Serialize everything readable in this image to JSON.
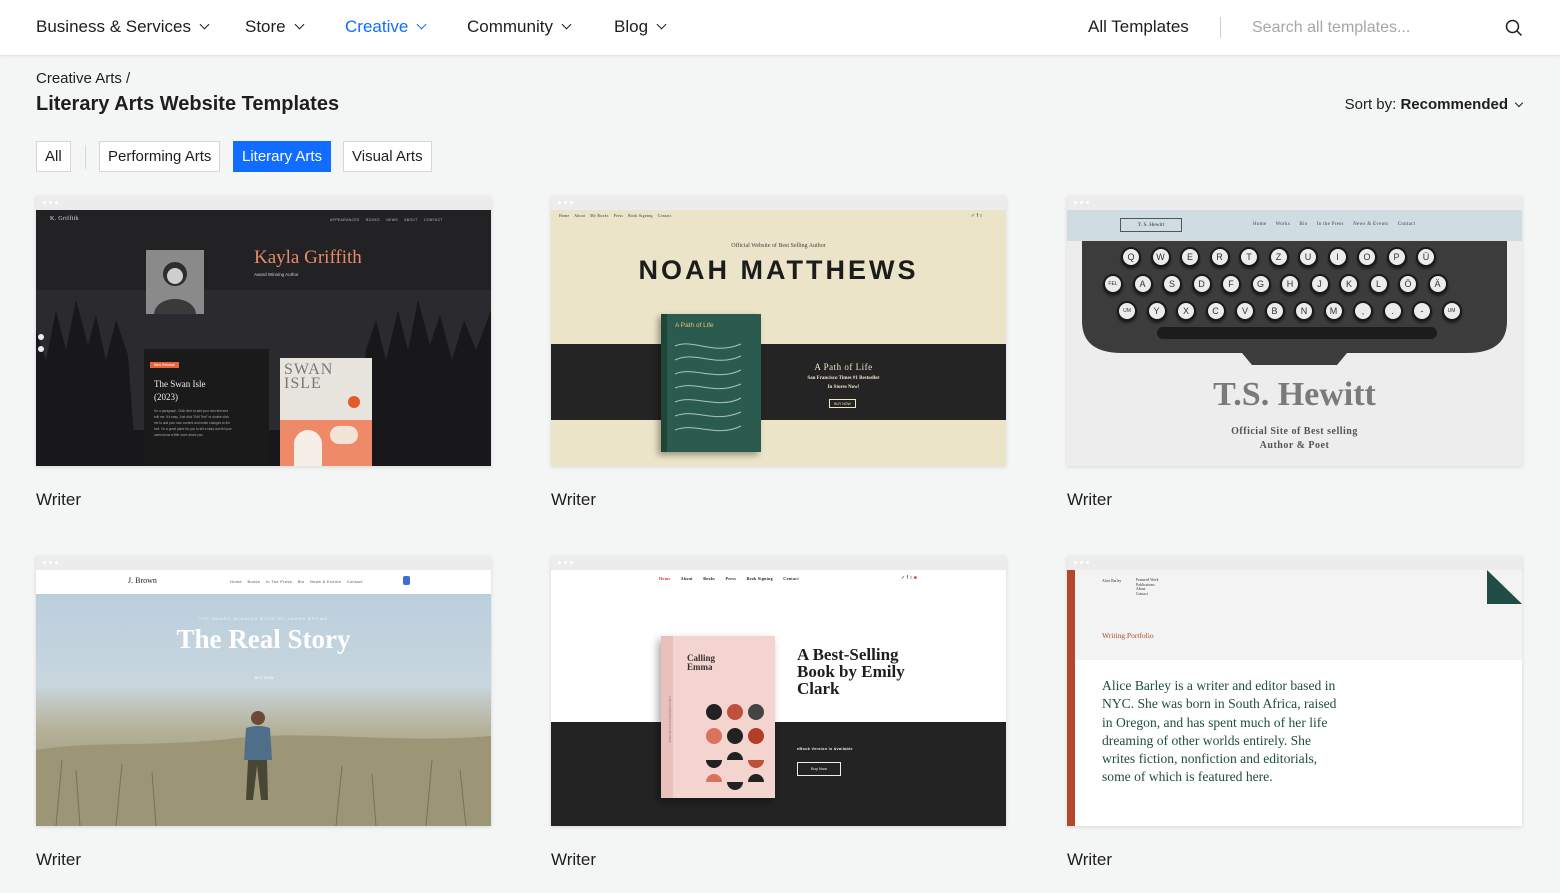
{
  "nav": {
    "items": [
      {
        "label": "Business & Services",
        "active": false
      },
      {
        "label": "Store",
        "active": false
      },
      {
        "label": "Creative",
        "active": true
      },
      {
        "label": "Community",
        "active": false
      },
      {
        "label": "Blog",
        "active": false
      }
    ],
    "all_templates": "All Templates",
    "search_placeholder": "Search all templates..."
  },
  "header": {
    "breadcrumb": "Creative Arts /",
    "title": "Literary Arts Website Templates",
    "sort_prefix": "Sort by:",
    "sort_value": "Recommended"
  },
  "filters": [
    {
      "label": "All",
      "active": false
    },
    {
      "label": "Performing Arts",
      "active": false
    },
    {
      "label": "Literary Arts",
      "active": true
    },
    {
      "label": "Visual Arts",
      "active": false
    }
  ],
  "colors": {
    "accent": "#116dff",
    "background": "#f4f5f5"
  },
  "cards": [
    {
      "label": "Writer",
      "preview": {
        "logo": "K. Griffith",
        "nav": [
          "APPEARANCES",
          "BOOKS",
          "NEWS",
          "ABOUT",
          "CONTACT"
        ],
        "name": "Kayla Griffith",
        "subtitle": "Award Winning Author",
        "badge": "New Release",
        "book_title": "The Swan Isle (2023)",
        "body": "I'm a paragraph. Click here to add your own text and edit me. It's easy. Just click \"Edit Text\" or double click me to add your own content and make changes to the font. I'm a great place for you to tell a story and let your users know a little more about you.",
        "cover_title": "SWAN ISLE"
      }
    },
    {
      "label": "Writer",
      "preview": {
        "nav": [
          "Home",
          "About",
          "My Books",
          "Press",
          "Book Signing",
          "Contact"
        ],
        "kicker": "Official Website of Best Selling Author",
        "name": "NOAH MATTHEWS",
        "cover_title": "A Path of Life",
        "book_title": "A Path of Life",
        "tagline_1": "San Francisco Times #1 Bestseller",
        "tagline_2": "In Stores Now!",
        "button": "BUY NOW"
      }
    },
    {
      "label": "Writer",
      "preview": {
        "logo": "T. S. Hewitt",
        "nav": [
          "Home",
          "Works",
          "Bio",
          "In the Press",
          "News & Events",
          "Contact"
        ],
        "keys_row1": [
          "Q",
          "W",
          "E",
          "R",
          "T",
          "Z",
          "U",
          "I",
          "O",
          "P",
          "Ü"
        ],
        "keys_row2": [
          "FEL",
          "A",
          "S",
          "D",
          "F",
          "G",
          "H",
          "J",
          "K",
          "L",
          "Ö",
          "Ä"
        ],
        "keys_row3": [
          "UM",
          "Y",
          "X",
          "C",
          "V",
          "B",
          "N",
          "M",
          ",",
          ".",
          "-",
          "UM"
        ],
        "name": "T.S. Hewitt",
        "subtitle_1": "Official Site of Best selling",
        "subtitle_2": "Author & Poet"
      }
    },
    {
      "label": "Writer",
      "preview": {
        "logo": "J. Brown",
        "nav": [
          "Home",
          "Books",
          "In The Press",
          "Bio",
          "News & Events",
          "Contact"
        ],
        "kicker": "THE AWARD-WINNING BOOK BY JAMES BROWN",
        "title": "The Real Story",
        "button": "BUY NOW"
      }
    },
    {
      "label": "Writer",
      "preview": {
        "nav": [
          "Home",
          "About",
          "Books",
          "Press",
          "Book Signing",
          "Contact"
        ],
        "cover_title": "Calling Emma",
        "spine": "A Best-Selling Book by Emily Clark",
        "title": "A Best-Selling Book by Emily Clark",
        "ebook": "eBook Version is Available",
        "button": "Buy Now"
      }
    },
    {
      "label": "Writer",
      "preview": {
        "logo": "Alice Barley",
        "nav": [
          "Featured Work",
          "Publications",
          "About",
          "Contact"
        ],
        "kicker": "Writing Portfolio",
        "body": "Alice Barley is a writer and editor based in NYC. She was born in South Africa, raised in Oregon, and has spent much of her life dreaming of other worlds entirely. She writes fiction, nonfiction and editorials, some of which is featured here."
      }
    }
  ]
}
